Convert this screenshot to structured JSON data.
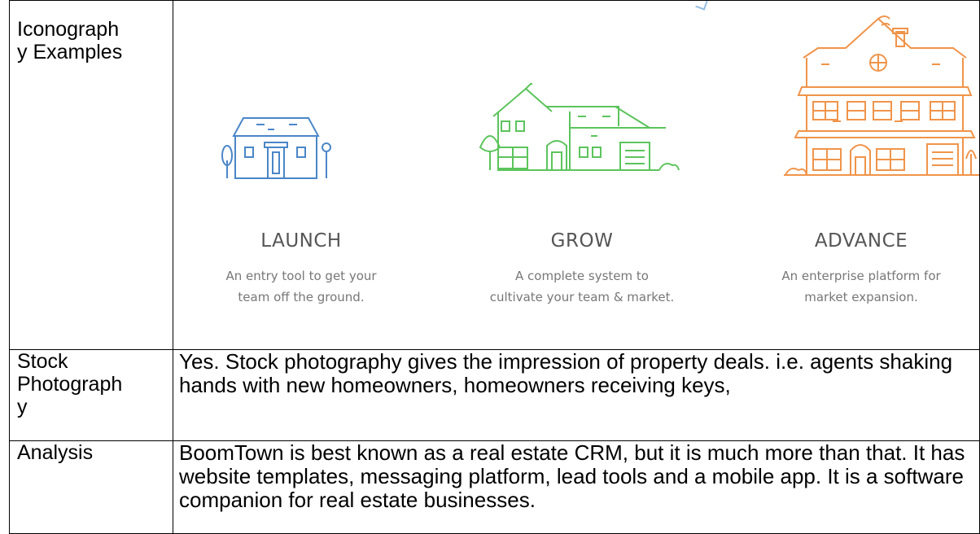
{
  "rows": [
    {
      "label": "Iconograph\ny Examples"
    },
    {
      "label": "Stock\nPhotograph\ny",
      "text": "Yes. Stock photography gives the impression of property deals. i.e. agents shaking hands with new homeowners, homeowners receiving keys,"
    },
    {
      "label": "Analysis",
      "text": "BoomTown is best known as a real estate CRM, but it is much more than that. It has website templates, messaging platform, lead tools and a mobile app. It is a software companion for real estate businesses."
    }
  ],
  "tiers": [
    {
      "title": "LAUNCH",
      "desc_line1": "An entry tool to get your",
      "desc_line2": "team off the ground.",
      "icon": "small-house-icon",
      "color": "#4a86c8"
    },
    {
      "title": "GROW",
      "desc_line1": "A complete system to",
      "desc_line2": "cultivate your team & market.",
      "icon": "medium-house-icon",
      "color": "#5cc45c"
    },
    {
      "title": "ADVANCE",
      "desc_line1": "An enterprise platform for",
      "desc_line2": "market expansion.",
      "icon": "large-house-icon",
      "color": "#f0944a"
    }
  ]
}
